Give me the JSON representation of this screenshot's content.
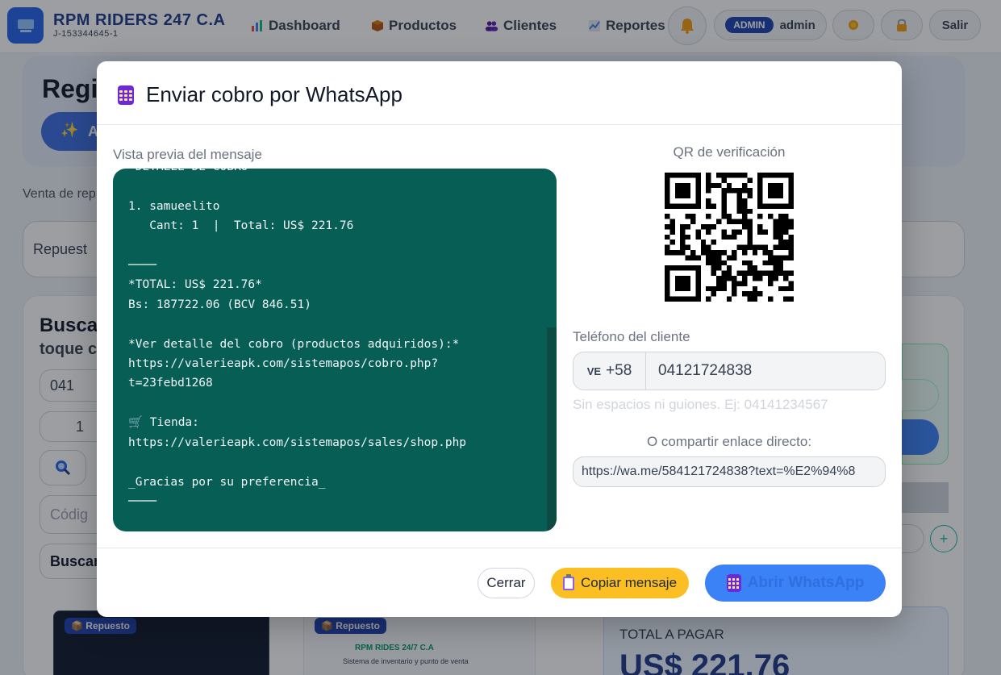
{
  "topbar": {
    "brand_name": "RPM RIDERS 247 C.A",
    "brand_rif": "J-153344645-1",
    "nav": [
      {
        "label": "Dashboard",
        "icon": "bar-chart-icon"
      },
      {
        "label": "Productos",
        "icon": "box-icon"
      },
      {
        "label": "Clientes",
        "icon": "users-icon"
      },
      {
        "label": "Reportes",
        "icon": "line-chart-icon"
      }
    ],
    "role_badge": "ADMIN",
    "username": "admin",
    "logout_label": "Salir"
  },
  "background": {
    "page_title": "Regi",
    "action_button_label": "A",
    "subtitle": "Venta de rep",
    "category_select": "Repuest",
    "search_title": "Buscar",
    "search_subtitle": "toque c",
    "code_value": "041",
    "qty_value": "1",
    "code_placeholder": "Códig",
    "search_button": "Buscar",
    "card_badge": "Repuesto",
    "card_badge_2": "Repuesto",
    "card_brand": "RPM RIDES 24/7 C.A",
    "card_brand_sub": "Sistema de inventario y punto de venta",
    "total_label": "TOTAL A PAGAR",
    "total_value": "US$ 221.76"
  },
  "modal": {
    "title": "Enviar cobro por WhatsApp",
    "preview_label": "Vista previa del mensaje",
    "message_lines": [
      "*DETALLE DE COBRO*",
      "",
      "1. samueelito",
      "   Cant: 1  |  Total: US$ 221.76",
      "",
      "────",
      "*TOTAL: US$ 221.76*",
      "Bs: 187722.06 (BCV 846.51)",
      "",
      "*Ver detalle del cobro (productos adquiridos):*",
      "https://valerieapk.com/sistemapos/cobro.php?",
      "t=23febd1268",
      "",
      "🛒 Tienda:",
      "https://valerieapk.com/sistemapos/sales/shop.php",
      "",
      "_Gracias por su preferencia_",
      "────"
    ],
    "qr_label": "QR de verificación",
    "phone_label": "Teléfono del cliente",
    "country_flag": "VE",
    "country_code": "+58",
    "phone_value": "04121724838",
    "phone_hint": "Sin espacios ni guiones. Ej: 04141234567",
    "share_label": "O compartir enlace directo:",
    "share_link": "https://wa.me/584121724838?text=%E2%94%8",
    "btn_close": "Cerrar",
    "btn_copy": "Copiar mensaje",
    "btn_open": "Abrir WhatsApp"
  },
  "colors": {
    "brand": "#1e3a8a",
    "whatsapp_bg": "#075e54",
    "copy_button": "#fbbf24",
    "open_button": "#3b82f6"
  }
}
